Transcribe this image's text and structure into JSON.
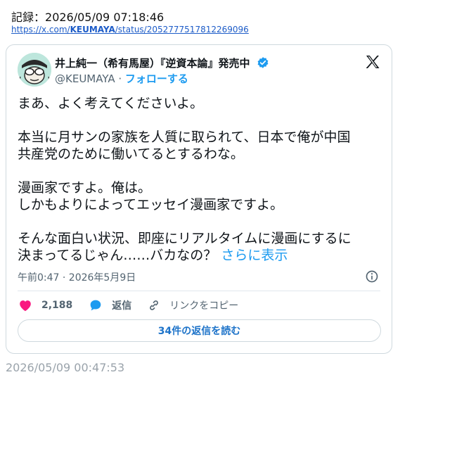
{
  "record": {
    "label": "記録：",
    "datetime": "2026/05/09 07:18:46"
  },
  "source": {
    "url_prefix": "https://x.com/",
    "url_user": "KEUMAYA",
    "url_suffix": "/status/2052777517812269096"
  },
  "tweet": {
    "author": {
      "display_name": "井上純一（希有馬屋）『逆資本論』発売中",
      "handle": "@KEUMAYA",
      "separator": " · ",
      "follow_label": "フォローする",
      "verified": true
    },
    "text": "まあ、よく考えてくださいよ。\n\n本当に月サンの家族を人質に取られて、日本で俺が中国\n共産党のために働いてるとするわな。\n\n漫画家ですよ。俺は。\nしかもよりによってエッセイ漫画家ですよ。\n\nそんな面白い状況、即座にリアルタイムに漫画にするに\n決まってるじゃん……バカなの？ ",
    "show_more_label": "さらに表示",
    "timestamp": "午前0:47 · 2026年5月9日",
    "likes": "2,188",
    "reply_label": "返信",
    "copy_link_label": "リンクをコピー",
    "read_replies_label": "34件の返信を読む",
    "icons": {
      "verified": "verified-badge-icon",
      "logo": "x-logo-icon",
      "info": "info-icon",
      "like": "heart-icon",
      "reply": "speech-bubble-icon",
      "copy": "link-icon"
    },
    "colors": {
      "accent": "#1d9bf0",
      "like": "#f91880",
      "text": "#0f1419",
      "muted": "#536471"
    }
  },
  "saved_time": "2026/05/09 00:47:53"
}
